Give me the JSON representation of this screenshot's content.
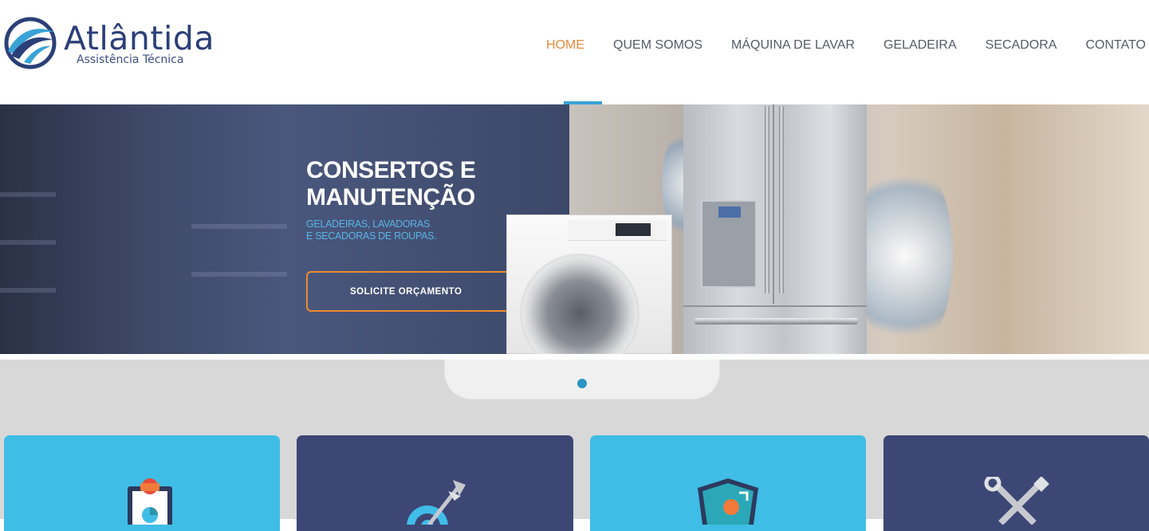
{
  "brand": {
    "name": "Atlântida",
    "tagline": "Assistência Técnica"
  },
  "nav": {
    "items": [
      {
        "label": "HOME",
        "active": true
      },
      {
        "label": "QUEM SOMOS",
        "active": false
      },
      {
        "label": "MÁQUINA DE LAVAR",
        "active": false
      },
      {
        "label": "GELADEIRA",
        "active": false
      },
      {
        "label": "SECADORA",
        "active": false
      },
      {
        "label": "CONTATO",
        "active": false
      }
    ]
  },
  "hero": {
    "title": "CONSERTOS E\nMANUTENÇÃO",
    "subtitle": "GELADEIRAS, LAVADORAS\nE SECADORAS DE ROUPAS.",
    "cta_label": "SOLICITE ORÇAMENTO"
  },
  "slider": {
    "active_slide": 1,
    "slide_count": 1
  },
  "cards": [
    {
      "icon": "clipboard-icon",
      "color": "#3fbde6"
    },
    {
      "icon": "target-arrow-icon",
      "color": "#3c4775"
    },
    {
      "icon": "shield-icon",
      "color": "#3fbde6"
    },
    {
      "icon": "tools-icon",
      "color": "#3c4775"
    }
  ],
  "colors": {
    "accent": "#e98a3b",
    "nav_text": "#555b66",
    "brand_blue": "#2b3f78",
    "hero_subtitle": "#5ab4e6",
    "indicator": "#3aa3d6",
    "card_light": "#3fbde6",
    "card_dark": "#3c4775"
  }
}
